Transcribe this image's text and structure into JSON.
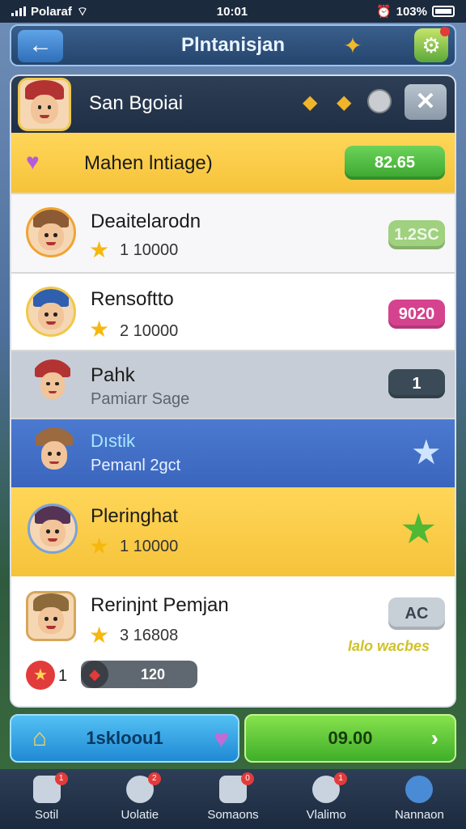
{
  "status": {
    "carrier": "Polaraf",
    "time": "10:01",
    "battery": "103%"
  },
  "topbar": {
    "title": "Plntanisjan",
    "back_icon": "arrow-left-icon",
    "coin_icon": "coin-icon",
    "gear_icon": "gear-icon"
  },
  "header": {
    "name": "San Bgoiai",
    "close_label": "✕"
  },
  "banner": {
    "label": "Mahen lntiage)",
    "button": "82.65"
  },
  "rows": [
    {
      "name": "Deaitelarodn",
      "sub": "1 10000",
      "pill": "1.2SC",
      "pill_color": "#9fd17e"
    },
    {
      "name": "Rensoftto",
      "sub": "2 10000",
      "pill": "9020",
      "pill_color": "#d5438f"
    },
    {
      "name": "Pahk",
      "sub": "Pamiarr Sage",
      "pill": "1",
      "pill_color": "#3a4a57"
    },
    {
      "name": "Dıstik",
      "sub": "Pemanl 2gct",
      "pill": "",
      "pill_color": "#86b6ea"
    },
    {
      "name": "Pleringhat",
      "sub": "1 10000",
      "pill": "",
      "pill_color": "#57c03b"
    },
    {
      "name": "Rerinjnt Pemjan",
      "sub": "3 16808",
      "pill": "AC",
      "pill_color": "#c7cfd7"
    }
  ],
  "footer_row": {
    "count": "1",
    "progress_value": "120",
    "tag": "Ialo wacbes"
  },
  "actions": {
    "left": "1skloou1",
    "right": "09.00"
  },
  "tabs": [
    {
      "label": "Sotil",
      "badge": "1",
      "icon": "home-icon"
    },
    {
      "label": "Uolatie",
      "badge": "2",
      "icon": "clock-icon"
    },
    {
      "label": "Somaons",
      "badge": "0",
      "icon": "list-icon"
    },
    {
      "label": "Vlalimo",
      "badge": "1",
      "icon": "ball-icon"
    },
    {
      "label": "Nannaon",
      "badge": "",
      "icon": "profile-icon"
    }
  ]
}
